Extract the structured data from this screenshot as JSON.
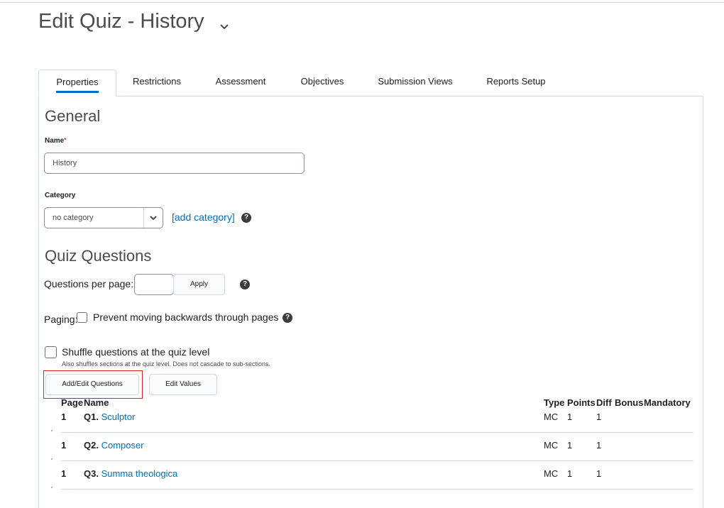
{
  "page": {
    "title": "Edit Quiz - History"
  },
  "tabs": [
    {
      "label": "Properties"
    },
    {
      "label": "Restrictions"
    },
    {
      "label": "Assessment"
    },
    {
      "label": "Objectives"
    },
    {
      "label": "Submission Views"
    },
    {
      "label": "Reports Setup"
    }
  ],
  "general": {
    "heading": "General",
    "name_label": "Name",
    "name_required_mark": "*",
    "name_value": "History",
    "category_label": "Category",
    "category_value": "no category",
    "add_category_link": "[add category]"
  },
  "quiz_questions": {
    "heading": "Quiz Questions",
    "per_page_label": "Questions per page:",
    "per_page_value": "",
    "apply_button": "Apply",
    "paging_label": "Paging:",
    "prevent_backwards_label": "Prevent moving backwards through pages",
    "shuffle_label": "Shuffle questions at the quiz level",
    "shuffle_note": "Also shuffles sections at the quiz level. Does not cascade to sub-sections.",
    "add_edit_button": "Add/Edit Questions",
    "edit_values_button": "Edit Values"
  },
  "table": {
    "headers": {
      "page": "Page",
      "name": "Name",
      "type": "Type",
      "points": "Points",
      "diff": "Diff",
      "bonus": "Bonus",
      "mandatory": "Mandatory"
    },
    "rows": [
      {
        "page": "1",
        "num": "Q1.",
        "name": "Sculptor",
        "type": "MC",
        "points": "1",
        "diff": "1"
      },
      {
        "page": "1",
        "num": "Q2.",
        "name": "Composer",
        "type": "MC",
        "points": "1",
        "diff": "1"
      },
      {
        "page": "1",
        "num": "Q3.",
        "name": "Summa theologica",
        "type": "MC",
        "points": "1",
        "diff": "1"
      }
    ]
  },
  "colors": {
    "accent": "#006fbf",
    "highlight": "#e02020"
  }
}
